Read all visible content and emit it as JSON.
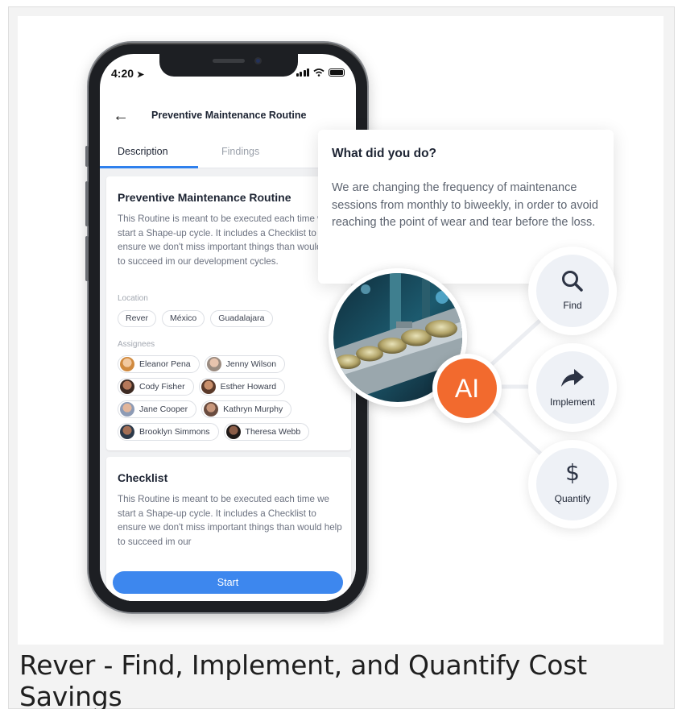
{
  "caption": "Rever - Find, Implement, and Quantify Cost Savings",
  "phone": {
    "status_time": "4:20",
    "nav_title": "Preventive Maintenance Routine",
    "tabs": [
      {
        "label": "Description",
        "active": true
      },
      {
        "label": "Findings",
        "active": false
      }
    ],
    "routine_card": {
      "title": "Preventive Maintenance Routine",
      "description": "This Routine is meant to be executed each time we start a Shape-up cycle. It includes a Checklist to ensure we don't miss important things than would help to succeed im our development cycles.",
      "location_label": "Location",
      "locations": [
        "Rever",
        "México",
        "Guadalajara"
      ],
      "assignees_label": "Assignees",
      "assignees": [
        [
          "Eleanor Pena",
          "Jenny Wilson"
        ],
        [
          "Cody Fisher",
          "Esther Howard"
        ],
        [
          "Jane Cooper",
          "Kathryn Murphy"
        ],
        [
          "Brooklyn Simmons",
          "Theresa Webb"
        ]
      ]
    },
    "checklist_card": {
      "title": "Checklist",
      "description": "This Routine is meant to be executed each time we start a Shape-up cycle. It includes a Checklist to ensure we don't miss important things than would help to succeed im our"
    },
    "start_label": "Start"
  },
  "popup": {
    "title": "What did you do?",
    "body": "We are changing the frequency of maintenance sessions from monthly to biweekly, in order to avoid reaching the point of wear and tear before the loss."
  },
  "ai_badge": "AI",
  "actions": [
    {
      "label": "Find",
      "icon": "search-icon"
    },
    {
      "label": "Implement",
      "icon": "share-arrow-icon"
    },
    {
      "label": "Quantify",
      "icon": "dollar-icon"
    }
  ],
  "colors": {
    "accent_blue": "#3d87ee",
    "ai_orange": "#f26a2e",
    "action_bg": "#eef1f6"
  }
}
